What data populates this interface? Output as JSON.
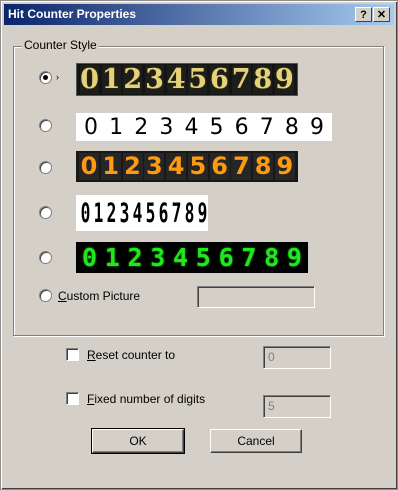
{
  "window": {
    "title": "Hit Counter Properties",
    "help_glyph": "?",
    "close_glyph": "✕"
  },
  "counter_style": {
    "group_label": "Counter Style",
    "selected_index": 0,
    "styles": [
      {
        "name": "gold-digits",
        "digits": [
          "0",
          "1",
          "2",
          "3",
          "4",
          "5",
          "6",
          "7",
          "8",
          "9"
        ]
      },
      {
        "name": "plain-digits",
        "digits": [
          "0",
          "1",
          "2",
          "3",
          "4",
          "5",
          "6",
          "7",
          "8",
          "9"
        ]
      },
      {
        "name": "orange-digits",
        "digits": [
          "0",
          "1",
          "2",
          "3",
          "4",
          "5",
          "6",
          "7",
          "8",
          "9"
        ]
      },
      {
        "name": "block-digits",
        "digits": [
          "0",
          "1",
          "2",
          "3",
          "4",
          "5",
          "6",
          "7",
          "8",
          "9"
        ]
      },
      {
        "name": "lcd-digits",
        "digits": [
          "0",
          "1",
          "2",
          "3",
          "4",
          "5",
          "6",
          "7",
          "8",
          "9"
        ]
      }
    ],
    "custom_picture_label_mnemonic": "C",
    "custom_picture_label_rest": "ustom Picture",
    "custom_picture_value": ""
  },
  "options": {
    "reset_label_mnemonic": "R",
    "reset_label_rest": "eset counter to",
    "reset_checked": false,
    "reset_value": "0",
    "fixed_label_mnemonic": "F",
    "fixed_label_rest": "ixed number of digits",
    "fixed_checked": false,
    "fixed_value": "5"
  },
  "buttons": {
    "ok": "OK",
    "cancel": "Cancel"
  }
}
